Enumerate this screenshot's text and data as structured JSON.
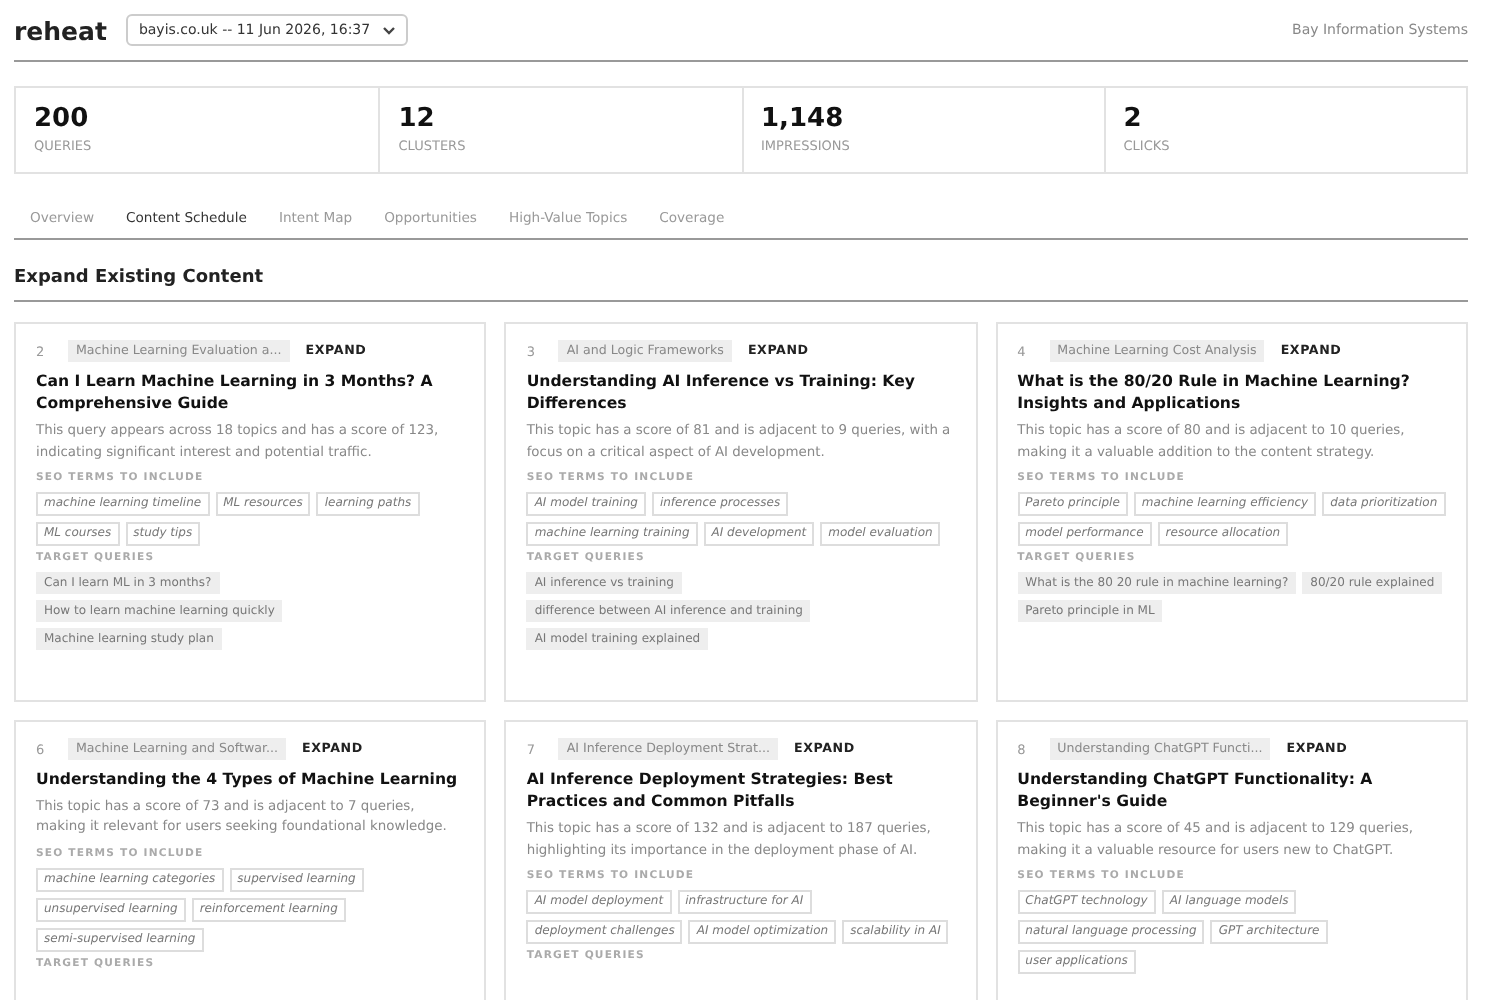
{
  "header": {
    "logo": "reheat",
    "site_select": "bayis.co.uk -- 11 Jun 2026, 16:37",
    "org": "Bay Information Systems"
  },
  "stats": [
    {
      "value": "200",
      "label": "QUERIES"
    },
    {
      "value": "12",
      "label": "CLUSTERS"
    },
    {
      "value": "1,148",
      "label": "IMPRESSIONS"
    },
    {
      "value": "2",
      "label": "CLICKS"
    }
  ],
  "tabs": [
    {
      "label": "Overview",
      "selected": false
    },
    {
      "label": "Content Schedule",
      "selected": true
    },
    {
      "label": "Intent Map",
      "selected": false
    },
    {
      "label": "Opportunities",
      "selected": false
    },
    {
      "label": "High-Value Topics",
      "selected": false
    },
    {
      "label": "Coverage",
      "selected": false
    }
  ],
  "section_title": "Expand Existing Content",
  "cards": [
    {
      "rank": "2",
      "topic": "Machine Learning Evaluation a...",
      "action": "EXPAND",
      "title": "Can I Learn Machine Learning in 3 Months? A Comprehensive Guide",
      "description": "This query appears across 18 topics and has a score of 123, indicating significant interest and potential traffic.",
      "seo_label": "SEO TERMS TO INCLUDE",
      "seo_terms": [
        "machine learning timeline",
        "ML resources",
        "learning paths",
        "ML courses",
        "study tips"
      ],
      "queries_label": "TARGET QUERIES",
      "queries": [
        "Can I learn ML in 3 months?",
        "How to learn machine learning quickly",
        "Machine learning study plan"
      ]
    },
    {
      "rank": "3",
      "topic": "AI and Logic Frameworks",
      "action": "EXPAND",
      "title": "Understanding AI Inference vs Training: Key Differences",
      "description": "This topic has a score of 81 and is adjacent to 9 queries, with a focus on a critical aspect of AI development.",
      "seo_label": "SEO TERMS TO INCLUDE",
      "seo_terms": [
        "AI model training",
        "inference processes",
        "machine learning training",
        "AI development",
        "model evaluation"
      ],
      "queries_label": "TARGET QUERIES",
      "queries": [
        "AI inference vs training",
        "difference between AI inference and training",
        "AI model training explained"
      ]
    },
    {
      "rank": "4",
      "topic": "Machine Learning Cost Analysis",
      "action": "EXPAND",
      "title": "What is the 80/20 Rule in Machine Learning? Insights and Applications",
      "description": "This topic has a score of 80 and is adjacent to 10 queries, making it a valuable addition to the content strategy.",
      "seo_label": "SEO TERMS TO INCLUDE",
      "seo_terms": [
        "Pareto principle",
        "machine learning efficiency",
        "data prioritization",
        "model performance",
        "resource allocation"
      ],
      "queries_label": "TARGET QUERIES",
      "queries": [
        "What is the 80 20 rule in machine learning?",
        "80/20 rule explained",
        "Pareto principle in ML"
      ]
    },
    {
      "rank": "6",
      "topic": "Machine Learning and Softwar...",
      "action": "EXPAND",
      "title": "Understanding the 4 Types of Machine Learning",
      "description": "This topic has a score of 73 and is adjacent to 7 queries, making it relevant for users seeking foundational knowledge.",
      "seo_label": "SEO TERMS TO INCLUDE",
      "seo_terms": [
        "machine learning categories",
        "supervised learning",
        "unsupervised learning",
        "reinforcement learning",
        "semi-supervised learning"
      ],
      "queries_label": "TARGET QUERIES"
    },
    {
      "rank": "7",
      "topic": "AI Inference Deployment Strat...",
      "action": "EXPAND",
      "title": "AI Inference Deployment Strategies: Best Practices and Common Pitfalls",
      "description": "This topic has a score of 132 and is adjacent to 187 queries, highlighting its importance in the deployment phase of AI.",
      "seo_label": "SEO TERMS TO INCLUDE",
      "seo_terms": [
        "AI model deployment",
        "infrastructure for AI",
        "deployment challenges",
        "AI model optimization",
        "scalability in AI"
      ],
      "queries_label": "TARGET QUERIES"
    },
    {
      "rank": "8",
      "topic": "Understanding ChatGPT Functi...",
      "action": "EXPAND",
      "title": "Understanding ChatGPT Functionality: A Beginner's Guide",
      "description": "This topic has a score of 45 and is adjacent to 129 queries, making it a valuable resource for users new to ChatGPT.",
      "seo_label": "SEO TERMS TO INCLUDE",
      "seo_terms": [
        "ChatGPT technology",
        "AI language models",
        "natural language processing",
        "GPT architecture",
        "user applications"
      ]
    }
  ]
}
